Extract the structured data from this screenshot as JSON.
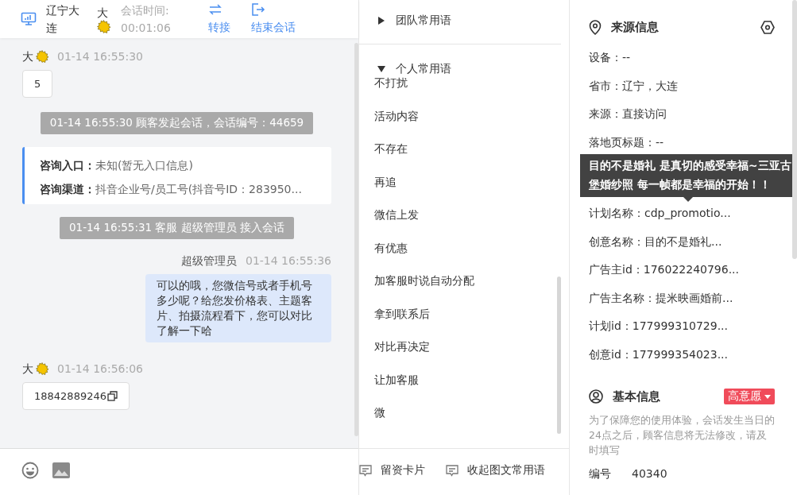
{
  "header": {
    "location": "辽宁大连",
    "visitor": "大",
    "session_label": "会话时间:",
    "session_time": "00:01:06",
    "actions": [
      {
        "kind": "transfer",
        "label": "转接"
      },
      {
        "kind": "end",
        "label": "结束会话"
      }
    ]
  },
  "messages": [
    {
      "kind": "customer",
      "sender": "大",
      "time": "01-14 16:55:30",
      "text": "5",
      "copyable": false
    },
    {
      "kind": "system",
      "text": "01-14 16:55:30 顾客发起会话，会话编号：44659"
    },
    {
      "kind": "info",
      "rows": [
        {
          "label": "咨询入口：",
          "value": "未知(暂无入口信息)"
        },
        {
          "label": "咨询渠道：",
          "value": "抖音企业号/员工号(抖音号ID：283950..."
        }
      ]
    },
    {
      "kind": "system",
      "text": "01-14 16:55:31 客服 超级管理员 接入会话"
    },
    {
      "kind": "agent",
      "sender": "超级管理员",
      "time": "01-14 16:55:36",
      "text": "可以的哦，您微信号或者手机号多少呢？给您发价格表、主题客片、拍摄流程看下，您可以对比了解一下哈"
    },
    {
      "kind": "customer",
      "sender": "大",
      "time": "01-14 16:56:06",
      "text": "18842889246",
      "copyable": true
    }
  ],
  "quick_replies": {
    "groups": [
      {
        "title": "团队常用语",
        "expanded": false
      },
      {
        "title": "个人常用语",
        "expanded": true,
        "items": [
          "不打扰",
          "活动内容",
          "不存在",
          "再追",
          "微信上发",
          "有优惠",
          "加客服时说自动分配",
          "拿到联系后",
          "对比再决定",
          "让加客服",
          "微"
        ]
      }
    ],
    "actions": [
      "留资卡片",
      "收起图文常用语"
    ]
  },
  "source_info": {
    "title": "来源信息",
    "rows": [
      {
        "kind": "row",
        "text": "设备：--"
      },
      {
        "kind": "row",
        "text": "省市：辽宁，大连"
      },
      {
        "kind": "row",
        "text": "来源：直接访问"
      },
      {
        "kind": "row",
        "text": "落地页标题：--"
      },
      {
        "kind": "tooltip",
        "text": "目的不是婚礼 是真切的感受幸福~三亚古堡婚纱照 每一帧都是幸福的开始！！"
      },
      {
        "kind": "row",
        "text": "计划名称：cdp_promotio..."
      },
      {
        "kind": "row",
        "text": "创意名称：目的不是婚礼..."
      },
      {
        "kind": "row",
        "text": "广告主id：176022240796..."
      },
      {
        "kind": "row",
        "text": "广告主名称：提米映画婚前..."
      },
      {
        "kind": "row",
        "text": "计划id：177999310729..."
      },
      {
        "kind": "row",
        "text": "创意id：177999354023..."
      }
    ]
  },
  "basic_info": {
    "title": "基本信息",
    "intent_tag": "高意愿",
    "note": "为了保障您的使用体验，会话发生当日的24点之后，顾客信息将无法修改，请及时填写",
    "fields": [
      {
        "label": "编号",
        "value": "40340"
      }
    ]
  }
}
